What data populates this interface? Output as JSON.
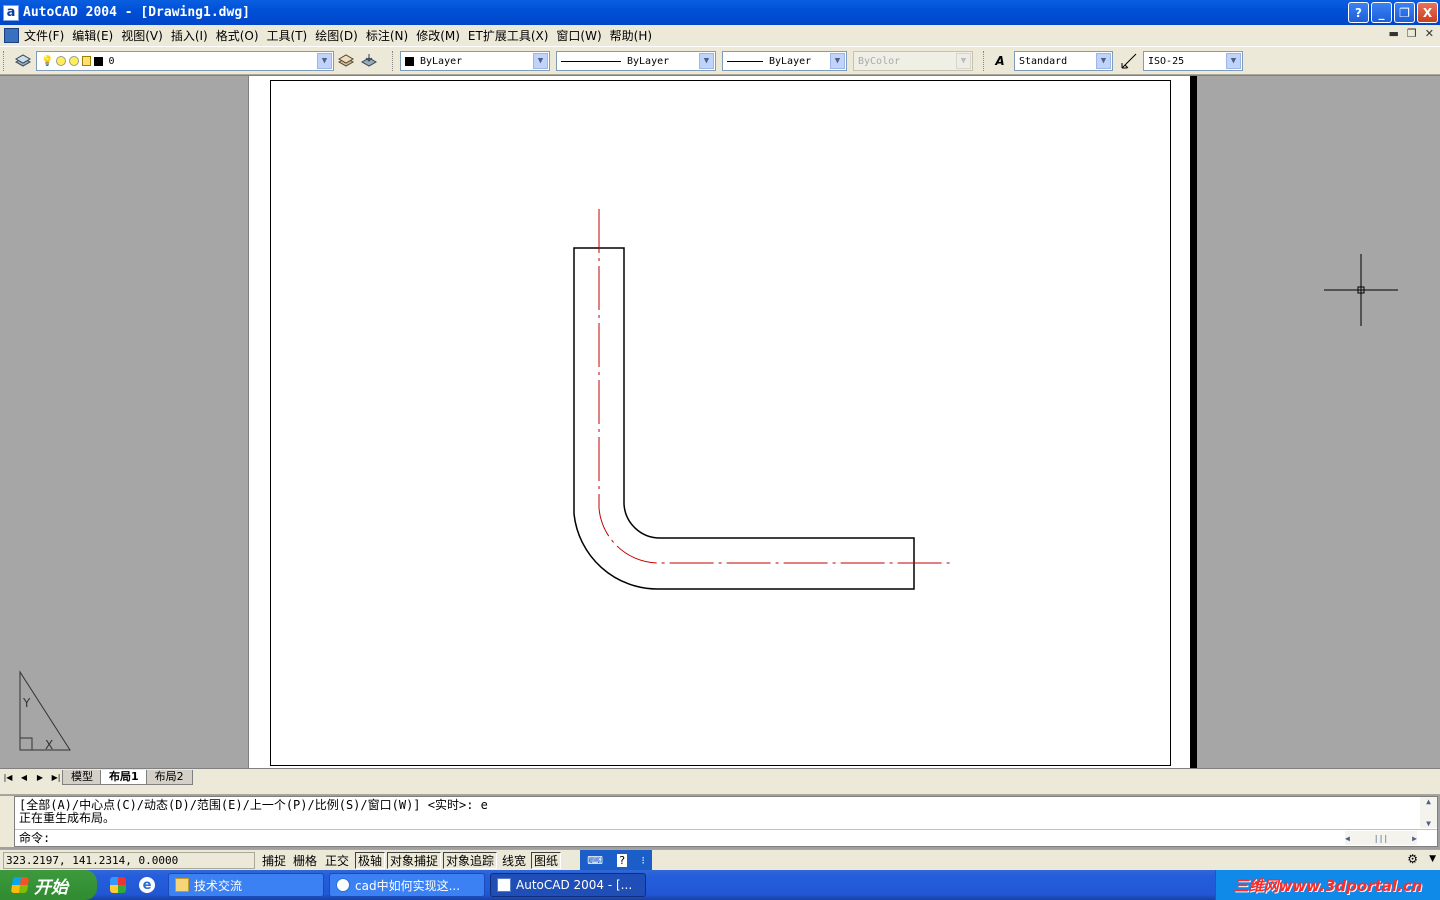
{
  "window": {
    "title": "AutoCAD 2004 - [Drawing1.dwg]",
    "app_icon": "a"
  },
  "window_buttons": {
    "help": "?",
    "minimize": "_",
    "maximize": "❐",
    "close": "X"
  },
  "menu": [
    "文件(F)",
    "编辑(E)",
    "视图(V)",
    "插入(I)",
    "格式(O)",
    "工具(T)",
    "绘图(D)",
    "标注(N)",
    "修改(M)",
    "ET扩展工具(X)",
    "窗口(W)",
    "帮助(H)"
  ],
  "toolbar": {
    "layer": "0",
    "color": "ByLayer",
    "linetype": "ByLayer",
    "lineweight": "ByLayer",
    "plotstyle": "ByColor",
    "text_style": "Standard",
    "dim_style": "ISO-25"
  },
  "tabs": [
    "模型",
    "布局1",
    "布局2"
  ],
  "active_tab": "布局1",
  "command": {
    "line1": "[全部(A)/中心点(C)/动态(D)/范围(E)/上一个(P)/比例(S)/窗口(W)] <实时>: e",
    "line2": "正在重生成布局。",
    "prompt": "命令:"
  },
  "status": {
    "coords": "323.2197, 141.2314, 0.0000",
    "toggles": [
      {
        "label": "捕捉",
        "on": false
      },
      {
        "label": "栅格",
        "on": false
      },
      {
        "label": "正交",
        "on": false
      },
      {
        "label": "极轴",
        "on": true
      },
      {
        "label": "对象捕捉",
        "on": true
      },
      {
        "label": "对象追踪",
        "on": true
      },
      {
        "label": "线宽",
        "on": false
      },
      {
        "label": "图纸",
        "on": true
      }
    ]
  },
  "taskbar": {
    "start": "开始",
    "tasks": [
      "技术交流",
      "cad中如何实现这...",
      "AutoCAD 2004 - [..."
    ],
    "watermark": "三维网www.3dportal.cn"
  },
  "ucs": {
    "x_label": "X",
    "y_label": "Y"
  },
  "colors": {
    "centerline": "#c00000",
    "outline": "#000000",
    "xp_blue": "#245edc"
  }
}
